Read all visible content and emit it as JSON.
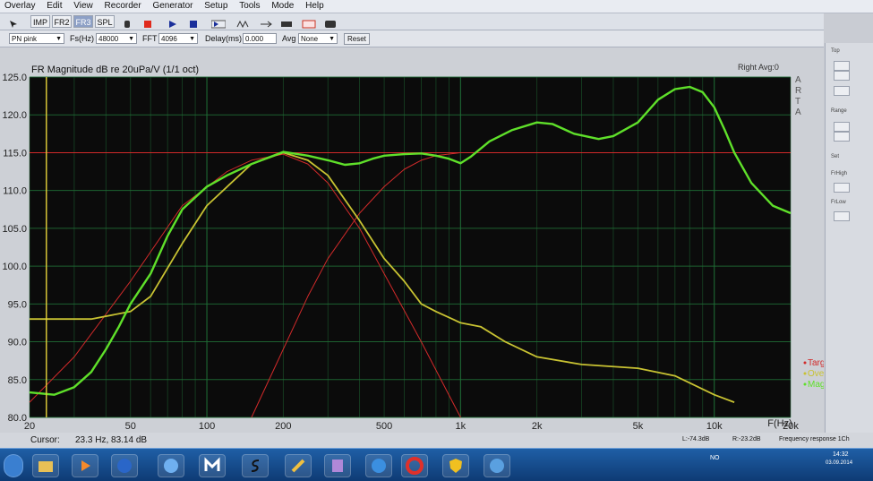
{
  "menubar": {
    "items": [
      "Overlay",
      "Edit",
      "View",
      "Recorder",
      "Generator",
      "Setup",
      "Tools",
      "Mode",
      "Help"
    ]
  },
  "toolbar": {
    "buttons": [
      "IMP",
      "FR2",
      "FR3",
      "SPL"
    ]
  },
  "params": {
    "signal_value": "PN pink",
    "fs_label": "Fs(Hz)",
    "fs_value": "48000",
    "fft_label": "FFT",
    "fft_value": "4096",
    "delay_label": "Delay(ms)",
    "delay_value": "0.000",
    "avg_label": "Avg",
    "avg_value": "None",
    "reset_label": "Reset"
  },
  "graph": {
    "title": "FR Magnitude dB re 20uPa/V (1/1 oct)",
    "right_label": "Right  Avg:0",
    "side_letters": [
      "A",
      "R",
      "T",
      "A"
    ]
  },
  "side_panel": {
    "labels": [
      "Top",
      "Range",
      "Set",
      "FrHigh",
      "FrLow"
    ]
  },
  "status": {
    "cursor_label": "Cursor:",
    "cursor_value": "23.3 Hz, 83.14 dB",
    "left_level": "L:-74.3dB",
    "right_level": "R:-23.2dB",
    "mode_text": "Frequency response 1Ch"
  },
  "taskbar": {
    "tray_lang": "NO",
    "time": "14:32",
    "date": "03.09.2014"
  },
  "colors": {
    "plot_bg": "#0b0b0b",
    "grid_green": "#1f6b35",
    "target": "#d12a2a",
    "overlay": "#c8c232",
    "magnitude": "#5fe02a"
  },
  "chart_data": {
    "type": "line",
    "title": "FR Magnitude dB re 20uPa/V (1/1 oct)",
    "xlabel": "F(Hz)",
    "ylabel": "",
    "xscale": "log",
    "xlim": [
      20,
      20000
    ],
    "ylim": [
      80,
      125
    ],
    "xticks": [
      20,
      50,
      100,
      200,
      500,
      1000,
      2000,
      5000,
      10000,
      20000
    ],
    "xtick_labels": [
      "20",
      "50",
      "100",
      "200",
      "500",
      "1k",
      "2k",
      "5k",
      "10k",
      "20k"
    ],
    "yticks": [
      80,
      85,
      90,
      95,
      100,
      105,
      110,
      115,
      120,
      125
    ],
    "ytick_labels": [
      "80.0",
      "85.0",
      "90.0",
      "95.0",
      "100.0",
      "105.0",
      "110.0",
      "115.0",
      "120.0",
      "125.0"
    ],
    "grid": true,
    "legend": "bottom-right",
    "reference_line": 115,
    "cursor_x": 23.3,
    "series": [
      {
        "name": "Targ",
        "color": "#d12a2a",
        "points": [
          [
            20,
            82
          ],
          [
            30,
            88
          ],
          [
            50,
            98
          ],
          [
            80,
            108
          ],
          [
            120,
            112.5
          ],
          [
            150,
            114
          ],
          [
            200,
            114.8
          ],
          [
            250,
            113.5
          ],
          [
            300,
            111
          ],
          [
            400,
            105
          ],
          [
            500,
            99
          ],
          [
            700,
            90
          ],
          [
            1000,
            80
          ]
        ]
      },
      {
        "name": "Targ",
        "color": "#d12a2a",
        "points": [
          [
            150,
            80
          ],
          [
            200,
            89
          ],
          [
            250,
            96
          ],
          [
            300,
            101
          ],
          [
            400,
            107
          ],
          [
            500,
            110.5
          ],
          [
            600,
            112.8
          ],
          [
            700,
            114
          ],
          [
            800,
            114.6
          ],
          [
            1000,
            115
          ]
        ]
      },
      {
        "name": "Over",
        "color": "#c8c232",
        "points": [
          [
            20,
            93
          ],
          [
            35,
            93
          ],
          [
            50,
            94
          ],
          [
            60,
            96
          ],
          [
            80,
            103
          ],
          [
            100,
            108
          ],
          [
            150,
            113.5
          ],
          [
            200,
            115
          ],
          [
            250,
            114
          ],
          [
            300,
            112
          ],
          [
            400,
            106
          ],
          [
            500,
            101
          ],
          [
            600,
            98
          ],
          [
            700,
            95
          ],
          [
            800,
            94
          ],
          [
            1000,
            92.5
          ],
          [
            1200,
            92
          ],
          [
            1500,
            90
          ],
          [
            2000,
            88
          ],
          [
            3000,
            87
          ],
          [
            5000,
            86.5
          ],
          [
            7000,
            85.5
          ],
          [
            10000,
            83
          ],
          [
            12000,
            82
          ]
        ]
      },
      {
        "name": "Magn",
        "color": "#5fe02a",
        "points": [
          [
            20,
            83.3
          ],
          [
            25,
            83
          ],
          [
            30,
            84
          ],
          [
            35,
            86
          ],
          [
            40,
            89
          ],
          [
            45,
            92
          ],
          [
            50,
            95
          ],
          [
            60,
            99
          ],
          [
            70,
            104
          ],
          [
            80,
            107.5
          ],
          [
            100,
            110.5
          ],
          [
            120,
            112
          ],
          [
            150,
            113.5
          ],
          [
            200,
            115.1
          ],
          [
            250,
            114.6
          ],
          [
            300,
            114
          ],
          [
            350,
            113.4
          ],
          [
            400,
            113.6
          ],
          [
            450,
            114.2
          ],
          [
            500,
            114.6
          ],
          [
            600,
            114.8
          ],
          [
            700,
            114.9
          ],
          [
            800,
            114.6
          ],
          [
            900,
            114.2
          ],
          [
            1000,
            113.6
          ],
          [
            1100,
            114.5
          ],
          [
            1300,
            116.5
          ],
          [
            1600,
            118
          ],
          [
            2000,
            119
          ],
          [
            2300,
            118.8
          ],
          [
            2800,
            117.5
          ],
          [
            3500,
            116.8
          ],
          [
            4000,
            117.2
          ],
          [
            5000,
            119
          ],
          [
            6000,
            122
          ],
          [
            7000,
            123.4
          ],
          [
            8000,
            123.7
          ],
          [
            9000,
            123
          ],
          [
            10000,
            121
          ],
          [
            11000,
            118
          ],
          [
            12000,
            115
          ],
          [
            14000,
            111
          ],
          [
            17000,
            108
          ],
          [
            20000,
            107
          ]
        ]
      }
    ]
  }
}
